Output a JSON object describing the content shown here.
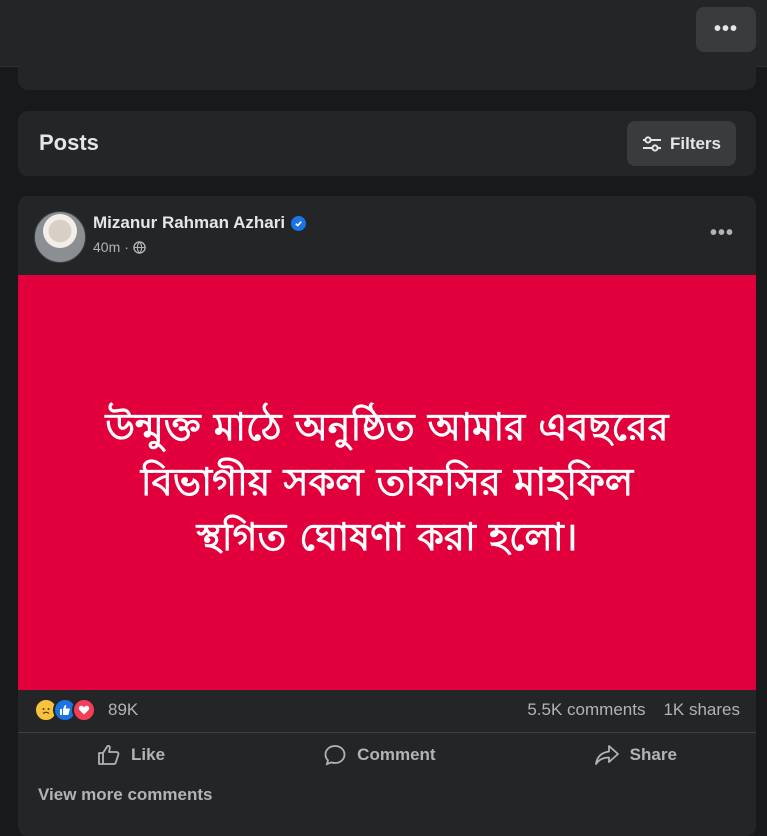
{
  "header": {
    "more_label": "•••"
  },
  "posts_section": {
    "title": "Posts",
    "filters_label": "Filters"
  },
  "post": {
    "author": "Mizanur Rahman Azhari",
    "time": "40m",
    "separator": "·",
    "more_label": "•••",
    "image_text": [
      "উন্মুক্ত মাঠে অনুষ্ঠিত আমার এবছরের",
      "বিভাগীয় সকল তাফসির মাহফিল",
      "স্থগিত ঘোষণা করা হলো।"
    ],
    "reaction_count": "89K",
    "comments": "5.5K comments",
    "shares": "1K shares",
    "actions": {
      "like": "Like",
      "comment": "Comment",
      "share": "Share"
    },
    "view_more_comments": "View more comments"
  },
  "colors": {
    "background": "#18191a",
    "card": "#242526",
    "button": "#3a3b3c",
    "image_bg": "#e2003c",
    "verified": "#1b74e4",
    "secondary_text": "#b0b3b8"
  }
}
